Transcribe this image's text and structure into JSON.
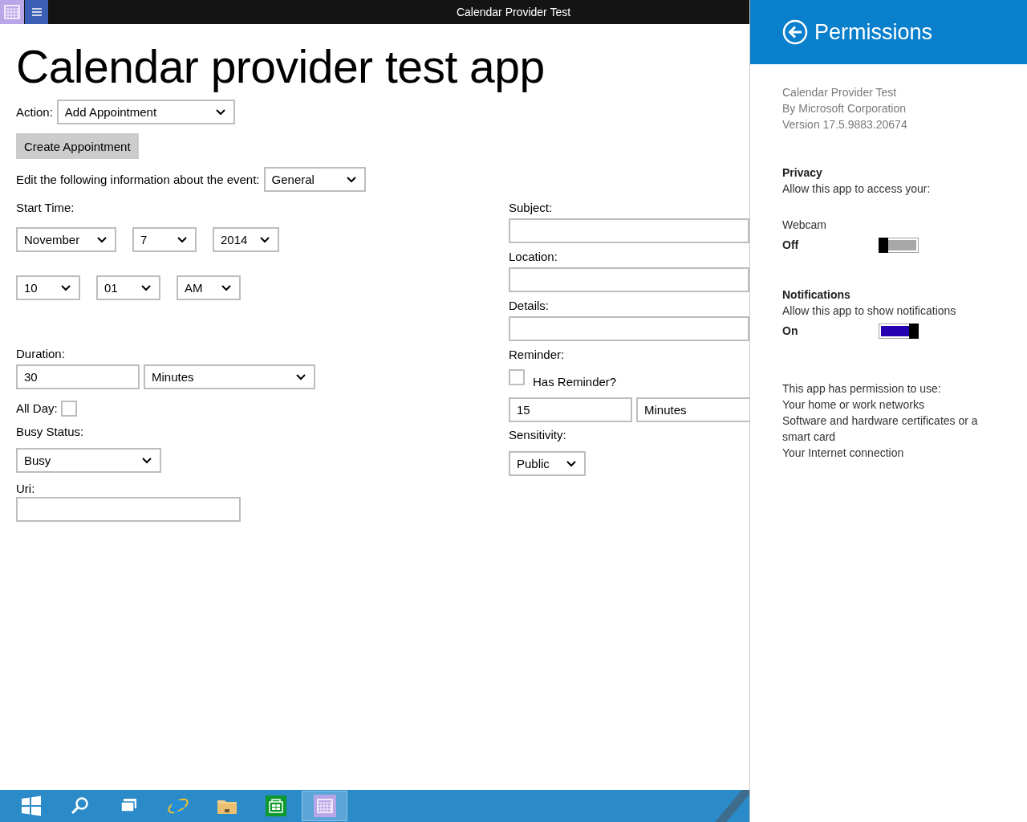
{
  "title_bar": {
    "title": "Calendar Provider Test"
  },
  "heading": "Calendar provider test app",
  "action": {
    "label": "Action:",
    "value": "Add Appointment"
  },
  "create_button": "Create Appointment",
  "edit_info": {
    "label": "Edit the following information about the event:",
    "value": "General"
  },
  "start_time": {
    "label": "Start Time:",
    "month": "November",
    "day": "7",
    "year": "2014",
    "hour": "10",
    "minute": "01",
    "ampm": "AM"
  },
  "duration": {
    "label": "Duration:",
    "value": "30",
    "unit": "Minutes"
  },
  "all_day": {
    "label": "All Day:",
    "checked": false
  },
  "busy_status": {
    "label": "Busy Status:",
    "value": "Busy"
  },
  "uri": {
    "label": "Uri:"
  },
  "subject": {
    "label": "Subject:"
  },
  "location": {
    "label": "Location:"
  },
  "details": {
    "label": "Details:"
  },
  "reminder": {
    "label": "Reminder:",
    "has_reminder": {
      "label": "Has Reminder?",
      "checked": false
    },
    "value": "15",
    "unit": "Minutes"
  },
  "sensitivity": {
    "label": "Sensitivity:",
    "value": "Public"
  },
  "panel": {
    "title": "Permissions",
    "app_info": [
      "Calendar Provider Test",
      "By Microsoft Corporation",
      "Version 17.5.9883.20674"
    ],
    "sections": [
      {
        "heading": "Privacy",
        "text": "Allow this app to access your:",
        "toggle": {
          "label": "Webcam",
          "state": "Off",
          "on": false
        }
      },
      {
        "heading": "Notifications",
        "text": "Allow this app to show notifications",
        "toggle": {
          "state": "On",
          "on": true
        }
      }
    ],
    "permissions": {
      "heading": "This app has permission to use:",
      "items": [
        "Your home or work networks",
        "Software and hardware certificates or a smart card",
        "Your Internet connection"
      ]
    }
  },
  "taskbar": {
    "items": [
      {
        "kind": "start",
        "selected": false
      },
      {
        "kind": "search",
        "selected": false
      },
      {
        "kind": "task-view",
        "selected": false
      },
      {
        "kind": "browser",
        "selected": false
      },
      {
        "kind": "folder",
        "selected": false
      },
      {
        "kind": "store",
        "selected": false
      },
      {
        "kind": "calendar",
        "selected": true
      }
    ]
  }
}
